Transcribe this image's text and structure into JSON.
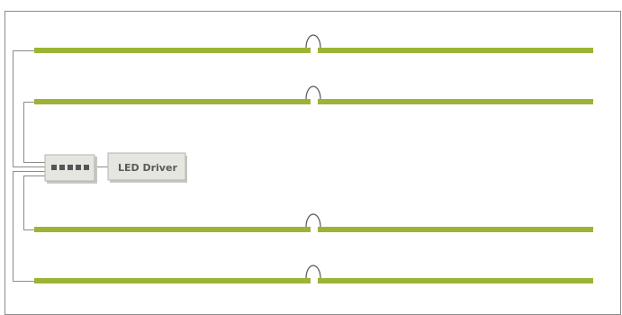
{
  "colors": {
    "strip": "#9cb436",
    "wire": "#8c8c8c",
    "frame": "#8c8c8c",
    "driver_fill": "#e6e6e1",
    "driver_border": "#b4b4ae",
    "port": "#555555",
    "label_text": "#5a5a5a"
  },
  "driver": {
    "label": "LED Driver",
    "port_count": 5
  },
  "strips": {
    "count": 4,
    "connectors_per_strip": 1
  }
}
